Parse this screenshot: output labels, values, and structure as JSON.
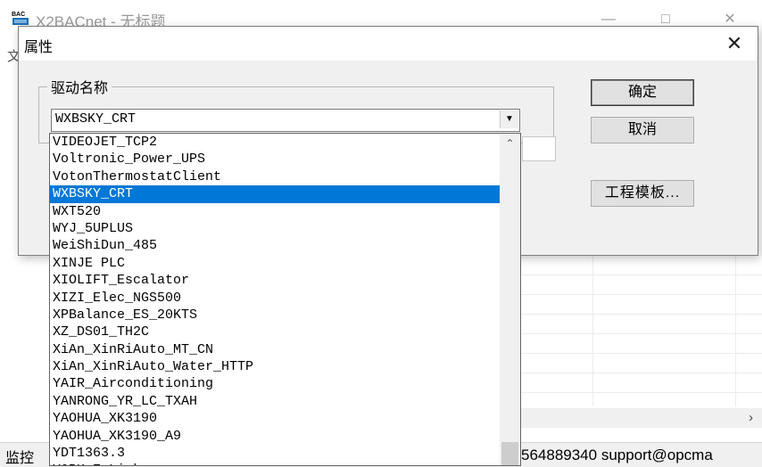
{
  "main_window": {
    "icon_text": "BAC",
    "title": "X2BACnet - 无标题",
    "menu_stub": "文",
    "status_left": "监控",
    "status_right": "564889340 support@opcma"
  },
  "dialog": {
    "title": "属性",
    "driver_group_label": "驱动名称",
    "driver_combo_value": "WXBSKY_CRT",
    "ok_label": "确定",
    "cancel_label": "取消",
    "template_label": "工程模板..."
  },
  "dropdown": {
    "items": [
      "VIDEOJET_TCP2",
      "Voltronic_Power_UPS",
      "VotonThermostatClient",
      "WXBSKY_CRT",
      "WXT520",
      "WYJ_5UPLUS",
      "WeiShiDun_485",
      "XINJE PLC",
      "XIOLIFT_Escalator",
      "XIZI_Elec_NGS500",
      "XPBalance_ES_20KTS",
      "XZ_DS01_TH2C",
      "XiAn_XinRiAuto_MT_CN",
      "XiAn_XinRiAuto_Water_HTTP",
      "YAIR_Airconditioning",
      "YANRONG_YR_LC_TXAH",
      "YAOHUA_XK3190",
      "YAOHUA_XK3190_A9",
      "YDT1363.3",
      "YORK_E_Link"
    ],
    "selected_index": 3
  },
  "colors": {
    "selection": "#0078d7",
    "dialog_bg": "#f0f0f0"
  }
}
